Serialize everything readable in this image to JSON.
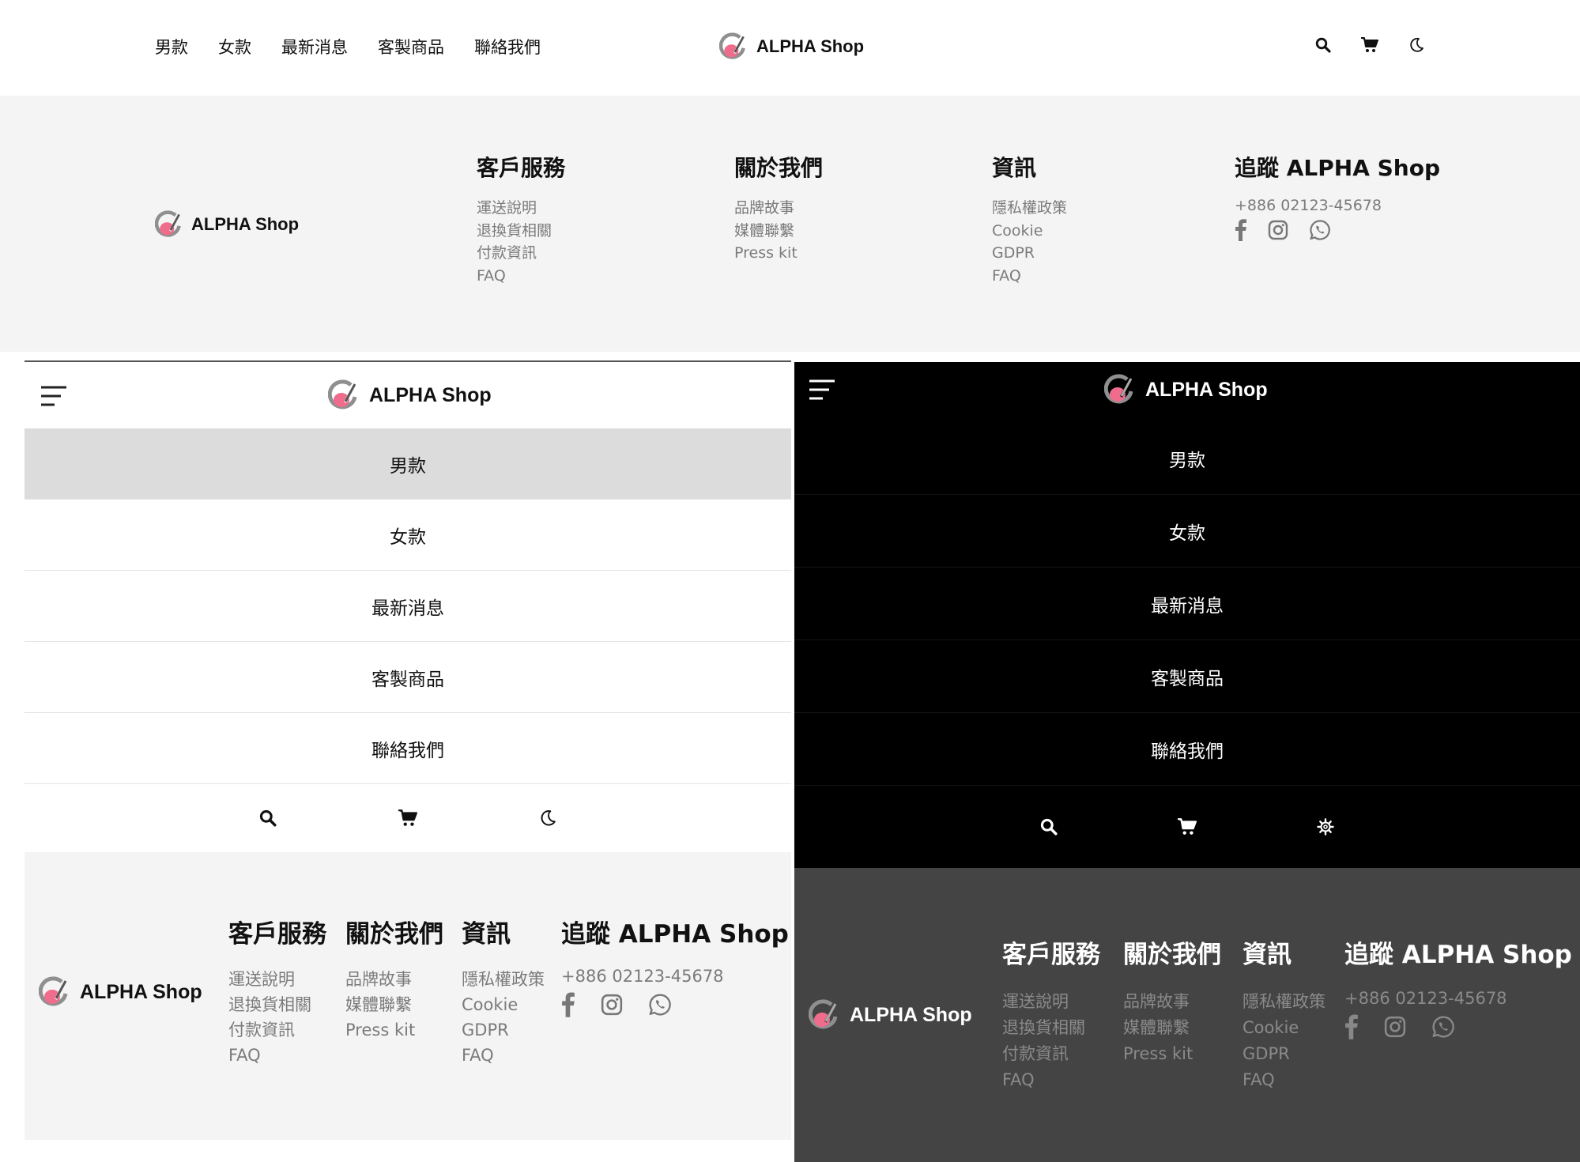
{
  "brand": {
    "name": "ALPHA Shop",
    "colors": {
      "pink": "#f06c8c",
      "grey": "#8f8f8f",
      "dark_bg": "#000000",
      "dark_footer": "#444444",
      "light_footer": "#f4f4f4"
    }
  },
  "nav": {
    "items": [
      "男款",
      "女款",
      "最新消息",
      "客製商品",
      "聯絡我們"
    ]
  },
  "header_icons": [
    "search-icon",
    "cart-icon",
    "moon-icon"
  ],
  "dark_header_icons": [
    "search-icon",
    "cart-icon",
    "gear-icon"
  ],
  "footer": {
    "columns": [
      {
        "title": "客戶服務",
        "links": [
          "運送說明",
          "退換貨相關",
          "付款資訊",
          "FAQ"
        ]
      },
      {
        "title": "關於我們",
        "links": [
          "品牌故事",
          "媒體聯繫",
          "Press kit"
        ]
      },
      {
        "title": "資訊",
        "links": [
          "隱私權政策",
          "Cookie",
          "GDPR",
          "FAQ"
        ]
      }
    ],
    "follow": {
      "title": "追蹤 ALPHA Shop",
      "phone": "+886 02123-45678",
      "social": [
        "facebook-icon",
        "instagram-icon",
        "whatsapp-icon"
      ]
    }
  }
}
